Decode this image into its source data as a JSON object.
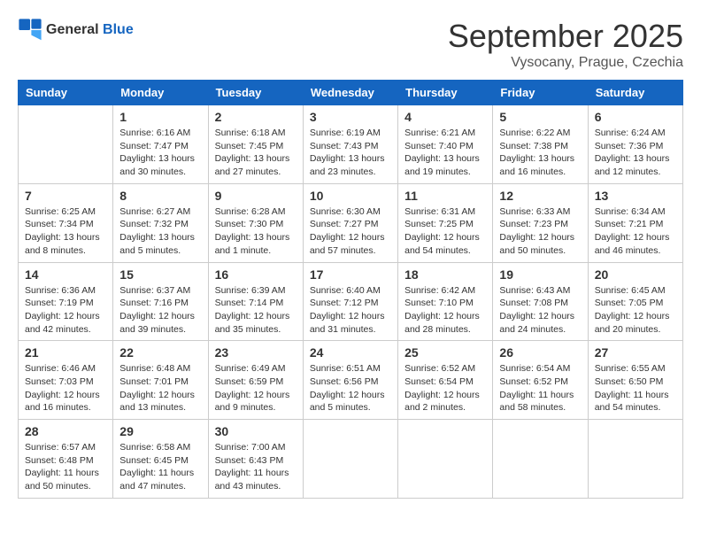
{
  "header": {
    "logo_general": "General",
    "logo_blue": "Blue",
    "month_title": "September 2025",
    "location": "Vysocany, Prague, Czechia"
  },
  "days_of_week": [
    "Sunday",
    "Monday",
    "Tuesday",
    "Wednesday",
    "Thursday",
    "Friday",
    "Saturday"
  ],
  "weeks": [
    [
      {
        "day": "",
        "info": ""
      },
      {
        "day": "1",
        "info": "Sunrise: 6:16 AM\nSunset: 7:47 PM\nDaylight: 13 hours\nand 30 minutes."
      },
      {
        "day": "2",
        "info": "Sunrise: 6:18 AM\nSunset: 7:45 PM\nDaylight: 13 hours\nand 27 minutes."
      },
      {
        "day": "3",
        "info": "Sunrise: 6:19 AM\nSunset: 7:43 PM\nDaylight: 13 hours\nand 23 minutes."
      },
      {
        "day": "4",
        "info": "Sunrise: 6:21 AM\nSunset: 7:40 PM\nDaylight: 13 hours\nand 19 minutes."
      },
      {
        "day": "5",
        "info": "Sunrise: 6:22 AM\nSunset: 7:38 PM\nDaylight: 13 hours\nand 16 minutes."
      },
      {
        "day": "6",
        "info": "Sunrise: 6:24 AM\nSunset: 7:36 PM\nDaylight: 13 hours\nand 12 minutes."
      }
    ],
    [
      {
        "day": "7",
        "info": "Sunrise: 6:25 AM\nSunset: 7:34 PM\nDaylight: 13 hours\nand 8 minutes."
      },
      {
        "day": "8",
        "info": "Sunrise: 6:27 AM\nSunset: 7:32 PM\nDaylight: 13 hours\nand 5 minutes."
      },
      {
        "day": "9",
        "info": "Sunrise: 6:28 AM\nSunset: 7:30 PM\nDaylight: 13 hours\nand 1 minute."
      },
      {
        "day": "10",
        "info": "Sunrise: 6:30 AM\nSunset: 7:27 PM\nDaylight: 12 hours\nand 57 minutes."
      },
      {
        "day": "11",
        "info": "Sunrise: 6:31 AM\nSunset: 7:25 PM\nDaylight: 12 hours\nand 54 minutes."
      },
      {
        "day": "12",
        "info": "Sunrise: 6:33 AM\nSunset: 7:23 PM\nDaylight: 12 hours\nand 50 minutes."
      },
      {
        "day": "13",
        "info": "Sunrise: 6:34 AM\nSunset: 7:21 PM\nDaylight: 12 hours\nand 46 minutes."
      }
    ],
    [
      {
        "day": "14",
        "info": "Sunrise: 6:36 AM\nSunset: 7:19 PM\nDaylight: 12 hours\nand 42 minutes."
      },
      {
        "day": "15",
        "info": "Sunrise: 6:37 AM\nSunset: 7:16 PM\nDaylight: 12 hours\nand 39 minutes."
      },
      {
        "day": "16",
        "info": "Sunrise: 6:39 AM\nSunset: 7:14 PM\nDaylight: 12 hours\nand 35 minutes."
      },
      {
        "day": "17",
        "info": "Sunrise: 6:40 AM\nSunset: 7:12 PM\nDaylight: 12 hours\nand 31 minutes."
      },
      {
        "day": "18",
        "info": "Sunrise: 6:42 AM\nSunset: 7:10 PM\nDaylight: 12 hours\nand 28 minutes."
      },
      {
        "day": "19",
        "info": "Sunrise: 6:43 AM\nSunset: 7:08 PM\nDaylight: 12 hours\nand 24 minutes."
      },
      {
        "day": "20",
        "info": "Sunrise: 6:45 AM\nSunset: 7:05 PM\nDaylight: 12 hours\nand 20 minutes."
      }
    ],
    [
      {
        "day": "21",
        "info": "Sunrise: 6:46 AM\nSunset: 7:03 PM\nDaylight: 12 hours\nand 16 minutes."
      },
      {
        "day": "22",
        "info": "Sunrise: 6:48 AM\nSunset: 7:01 PM\nDaylight: 12 hours\nand 13 minutes."
      },
      {
        "day": "23",
        "info": "Sunrise: 6:49 AM\nSunset: 6:59 PM\nDaylight: 12 hours\nand 9 minutes."
      },
      {
        "day": "24",
        "info": "Sunrise: 6:51 AM\nSunset: 6:56 PM\nDaylight: 12 hours\nand 5 minutes."
      },
      {
        "day": "25",
        "info": "Sunrise: 6:52 AM\nSunset: 6:54 PM\nDaylight: 12 hours\nand 2 minutes."
      },
      {
        "day": "26",
        "info": "Sunrise: 6:54 AM\nSunset: 6:52 PM\nDaylight: 11 hours\nand 58 minutes."
      },
      {
        "day": "27",
        "info": "Sunrise: 6:55 AM\nSunset: 6:50 PM\nDaylight: 11 hours\nand 54 minutes."
      }
    ],
    [
      {
        "day": "28",
        "info": "Sunrise: 6:57 AM\nSunset: 6:48 PM\nDaylight: 11 hours\nand 50 minutes."
      },
      {
        "day": "29",
        "info": "Sunrise: 6:58 AM\nSunset: 6:45 PM\nDaylight: 11 hours\nand 47 minutes."
      },
      {
        "day": "30",
        "info": "Sunrise: 7:00 AM\nSunset: 6:43 PM\nDaylight: 11 hours\nand 43 minutes."
      },
      {
        "day": "",
        "info": ""
      },
      {
        "day": "",
        "info": ""
      },
      {
        "day": "",
        "info": ""
      },
      {
        "day": "",
        "info": ""
      }
    ]
  ]
}
